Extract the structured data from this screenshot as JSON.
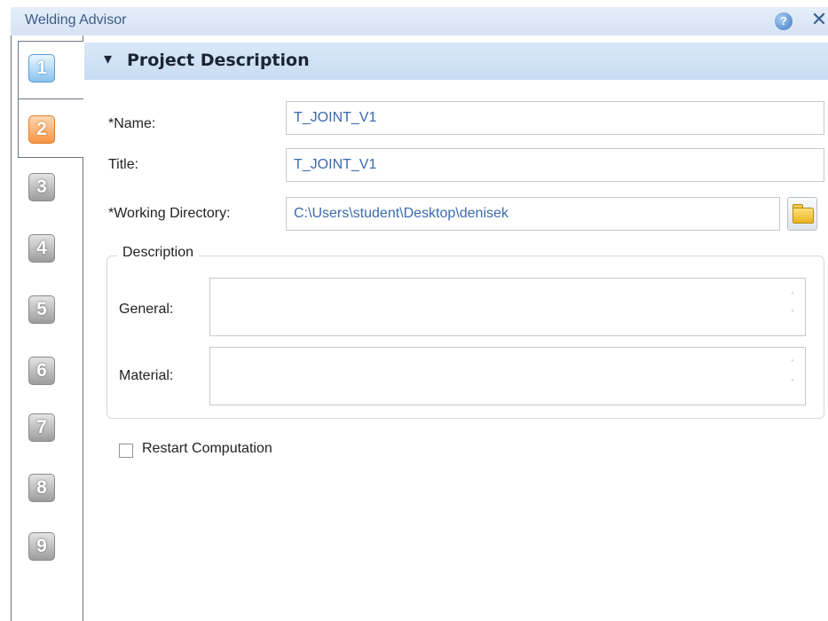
{
  "window": {
    "title": "Welding Advisor",
    "help_glyph": "?",
    "close_glyph": "✕"
  },
  "steps": [
    "1",
    "2",
    "3",
    "4",
    "5",
    "6",
    "7",
    "8",
    "9"
  ],
  "section": {
    "title": "Project Description",
    "collapse_glyph": "▾"
  },
  "fields": {
    "name": {
      "label": "*Name:",
      "value": "T_JOINT_V1"
    },
    "title": {
      "label": "Title:",
      "value": "T_JOINT_V1"
    },
    "working_directory": {
      "label": "*Working Directory:",
      "value": "C:\\Users\\student\\Desktop\\denisek"
    }
  },
  "description": {
    "legend": "Description",
    "general_label": "General:",
    "material_label": "Material:",
    "scroll_up": "˄",
    "scroll_down": "˅"
  },
  "restart": {
    "label": "Restart Computation",
    "checked": false
  },
  "colors": {
    "accent": "#3d5a86",
    "value_text": "#3a6ab0",
    "header_bg": "#d0e2f5"
  },
  "icons": {
    "help": "help-circle-icon",
    "close": "close-icon",
    "folder": "folder-open-icon"
  }
}
